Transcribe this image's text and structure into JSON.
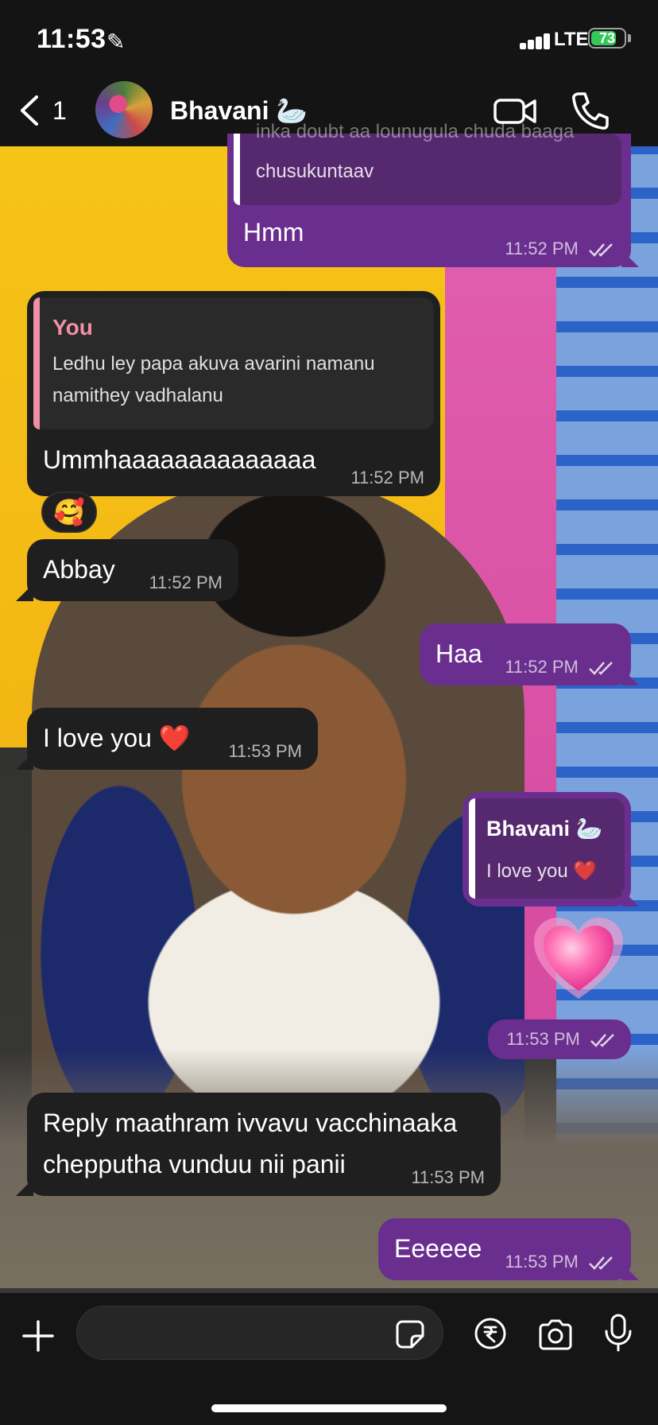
{
  "status_bar": {
    "time": "11:53",
    "network": "LTE",
    "battery": "73"
  },
  "header": {
    "back_count": "1",
    "contact_name": "Bhavani 🦢"
  },
  "messages": [
    {
      "direction": "outgoing",
      "quote_text": "chusukuntaav",
      "quote_text_partial": "inka doubt aa lounugula chuda baaga",
      "text": "Hmm",
      "time": "11:52 PM",
      "status": "read"
    },
    {
      "direction": "incoming",
      "quote_name": "You",
      "quote_text": "Ledhu ley papa akuva avarini namanu namithey vadhalanu",
      "text": "Ummhaaaaaaaaaaaaaa",
      "time": "11:52 PM",
      "reaction": "🥰"
    },
    {
      "direction": "incoming",
      "text": "Abbay",
      "time": "11:52 PM"
    },
    {
      "direction": "outgoing",
      "text": "Haa",
      "time": "11:52 PM",
      "status": "read"
    },
    {
      "direction": "incoming",
      "text": "I love you ❤️",
      "time": "11:53 PM"
    },
    {
      "direction": "outgoing",
      "quote_name": "Bhavani 🦢",
      "quote_text": "I love you ❤️",
      "sticker": "💗",
      "time": "11:53 PM",
      "status": "read"
    },
    {
      "direction": "incoming",
      "text_line1": "Reply maathram ivvavu vacchinaaka",
      "text_line2": "chepputha vunduu nii panii",
      "time": "11:53 PM"
    },
    {
      "direction": "outgoing",
      "text": "Eeeeee",
      "time": "11:53 PM",
      "status": "read"
    }
  ],
  "input_bar": {
    "placeholder": ""
  },
  "colors": {
    "outgoing_bubble": "#6a2f8e",
    "incoming_bubble": "#1f1f1f",
    "you_quote_name": "#f08fa8",
    "battery_green": "#35c759"
  },
  "icons": [
    "back-chevron-icon",
    "video-call-icon",
    "phone-call-icon",
    "plus-icon",
    "sticker-icon",
    "rupee-payment-icon",
    "camera-icon",
    "microphone-icon",
    "double-check-icon",
    "pencil-icon",
    "signal-icon",
    "battery-icon"
  ]
}
